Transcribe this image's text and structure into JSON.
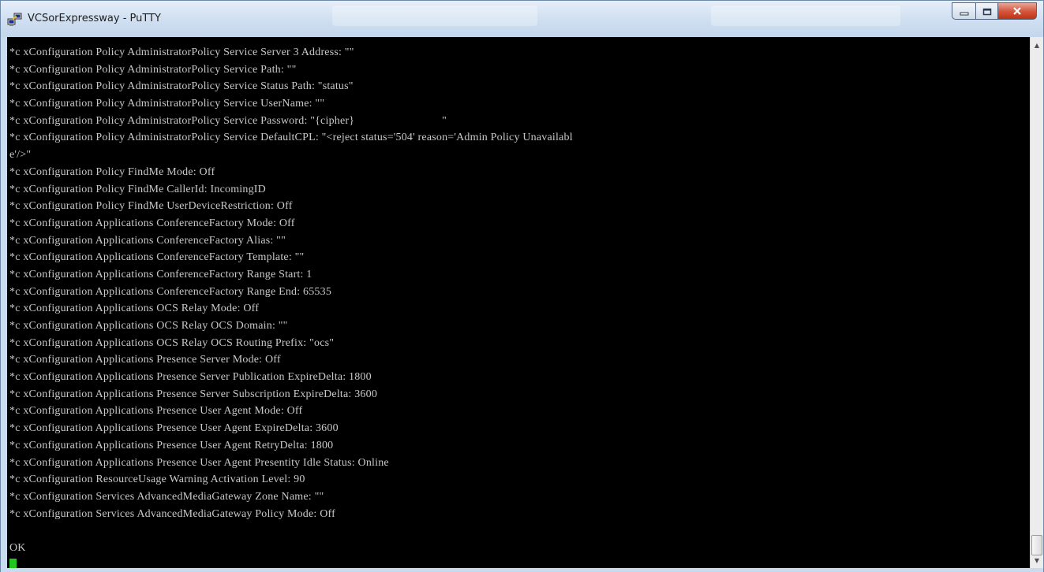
{
  "window": {
    "title": "VCSorExpressway - PuTTY",
    "accent": "#c9dbee",
    "icons": {
      "app": "putty-icon",
      "minimize": "minimize-icon",
      "maximize": "maximize-icon",
      "close": "close-icon"
    }
  },
  "terminal": {
    "background": "#000000",
    "foreground": "#c8c8c8",
    "cursor_color": "#1ec81e",
    "lines": [
      "*c xConfiguration Policy AdministratorPolicy Service Server 3 Address: \"\"",
      "*c xConfiguration Policy AdministratorPolicy Service Path: \"\"",
      "*c xConfiguration Policy AdministratorPolicy Service Status Path: \"status\"",
      "*c xConfiguration Policy AdministratorPolicy Service UserName: \"\"",
      "*c xConfiguration Policy AdministratorPolicy Service Password: \"{cipher}                              \"",
      "*c xConfiguration Policy AdministratorPolicy Service DefaultCPL: \"<reject status='504' reason='Admin Policy Unavailabl",
      "e'/>\"",
      "*c xConfiguration Policy FindMe Mode: Off",
      "*c xConfiguration Policy FindMe CallerId: IncomingID",
      "*c xConfiguration Policy FindMe UserDeviceRestriction: Off",
      "*c xConfiguration Applications ConferenceFactory Mode: Off",
      "*c xConfiguration Applications ConferenceFactory Alias: \"\"",
      "*c xConfiguration Applications ConferenceFactory Template: \"\"",
      "*c xConfiguration Applications ConferenceFactory Range Start: 1",
      "*c xConfiguration Applications ConferenceFactory Range End: 65535",
      "*c xConfiguration Applications OCS Relay Mode: Off",
      "*c xConfiguration Applications OCS Relay OCS Domain: \"\"",
      "*c xConfiguration Applications OCS Relay OCS Routing Prefix: \"ocs\"",
      "*c xConfiguration Applications Presence Server Mode: Off",
      "*c xConfiguration Applications Presence Server Publication ExpireDelta: 1800",
      "*c xConfiguration Applications Presence Server Subscription ExpireDelta: 3600",
      "*c xConfiguration Applications Presence User Agent Mode: Off",
      "*c xConfiguration Applications Presence User Agent ExpireDelta: 3600",
      "*c xConfiguration Applications Presence User Agent RetryDelta: 1800",
      "*c xConfiguration Applications Presence User Agent Presentity Idle Status: Online",
      "*c xConfiguration ResourceUsage Warning Activation Level: 90",
      "*c xConfiguration Services AdvancedMediaGateway Zone Name: \"\"",
      "*c xConfiguration Services AdvancedMediaGateway Policy Mode: Off",
      "",
      "OK"
    ]
  },
  "scrollbar": {
    "position": "bottom"
  }
}
